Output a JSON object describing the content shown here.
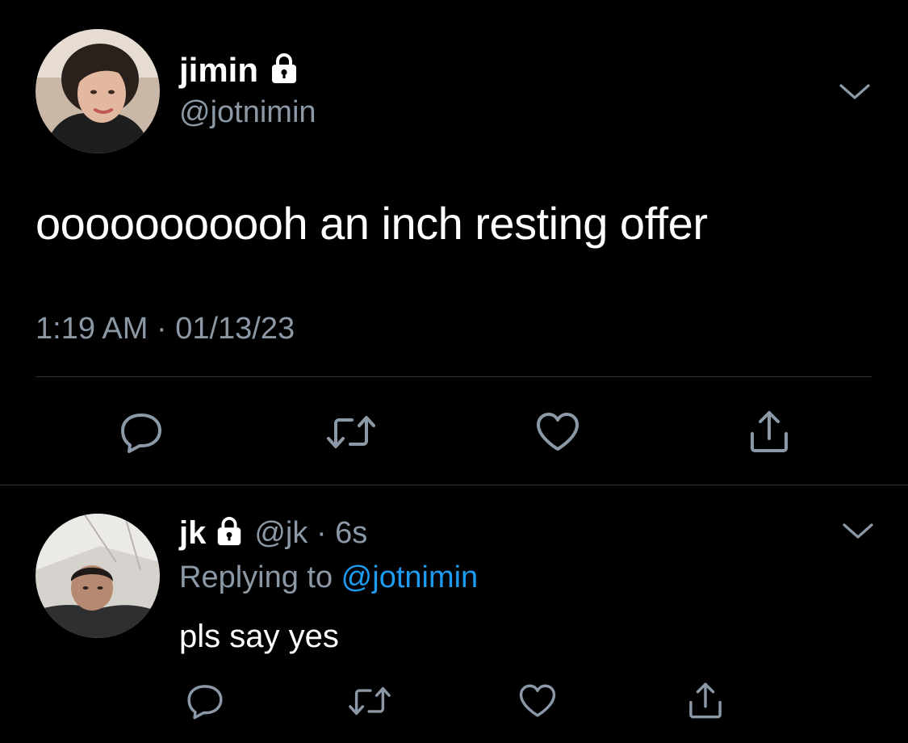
{
  "main_tweet": {
    "display_name": "jimin",
    "handle": "@jotnimin",
    "text": "ooooooooooh an inch resting offer",
    "timestamp": "1:19 AM · 01/13/23",
    "avatar_icon": "profile-photo",
    "locked_icon": "lock-icon"
  },
  "reply_tweet": {
    "display_name": "jk",
    "handle": "@jk",
    "separator": " · ",
    "age": "6s",
    "replying_prefix": "Replying to ",
    "replying_to": "@jotnimin",
    "text": "pls say yes"
  },
  "actions": [
    "reply-icon",
    "retweet-icon",
    "like-icon",
    "share-icon"
  ],
  "colors": {
    "background": "#000000",
    "text": "#ffffff",
    "secondary": "#8b98a5",
    "link": "#1d9bf0",
    "divider": "#2f3336"
  }
}
